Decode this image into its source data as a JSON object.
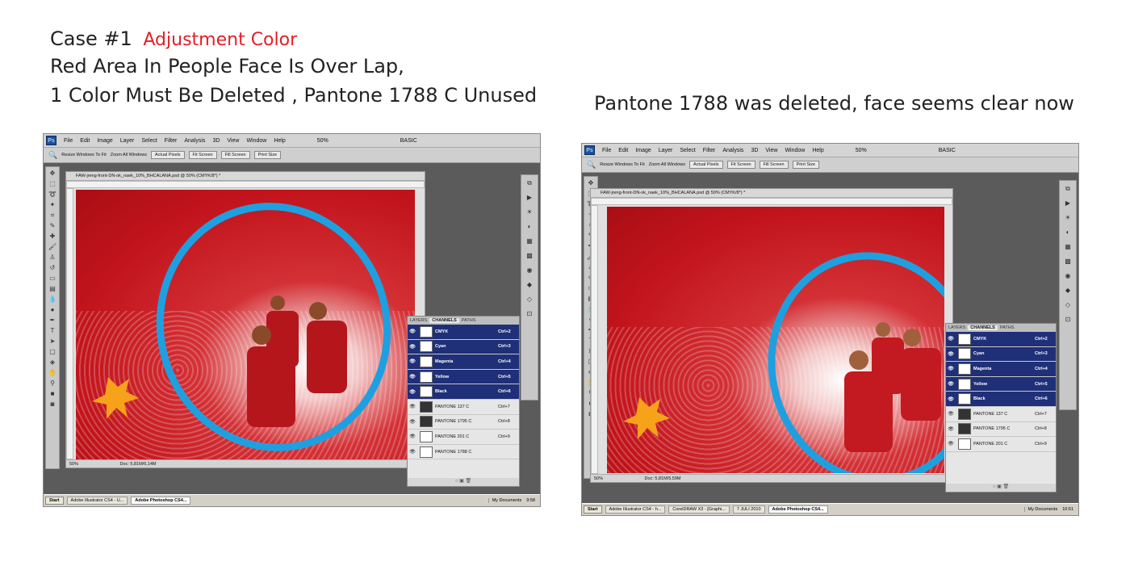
{
  "left_caption": {
    "case": "Case #1",
    "label": "Adjustment Color",
    "line2": "Red Area In People Face Is Over Lap,",
    "line3": "1 Color Must Be Deleted , Pantone 1788 C  Unused"
  },
  "right_caption": "Pantone 1788 was deleted, face seems clear now",
  "ps": {
    "logo": "Ps",
    "menus": [
      "File",
      "Edit",
      "Image",
      "Layer",
      "Select",
      "Filter",
      "Analysis",
      "3D",
      "View",
      "Window",
      "Help"
    ],
    "zoom_field": "50%",
    "workspace": "BASIC",
    "options": {
      "resize": "Resize Windows To Fit",
      "zoom_all": "Zoom All Windows",
      "actual": "Actual Pixels",
      "fit": "Fit Screen",
      "fill": "Fill Screen",
      "print": "Print Size"
    },
    "doc_title": "FAW-jreng-front-DN-ok_naek_10%_BHCALANA.psd @ 50% (CMYK/8*) *",
    "tabs": {
      "layers": "LAYERS",
      "channels": "CHANNELS",
      "paths": "PATHS"
    }
  },
  "left": {
    "status_zoom": "50%",
    "status_doc": "Doc: 5,81M/6,14M",
    "channels": [
      {
        "name": "CMYK",
        "key": "Ctrl+2",
        "sel": true
      },
      {
        "name": "Cyan",
        "key": "Ctrl+3",
        "sel": true
      },
      {
        "name": "Magenta",
        "key": "Ctrl+4",
        "sel": true
      },
      {
        "name": "Yellow",
        "key": "Ctrl+5",
        "sel": true
      },
      {
        "name": "Black",
        "key": "Ctrl+6",
        "sel": true
      },
      {
        "name": "PANTONE 137 C",
        "key": "Ctrl+7",
        "sel": false
      },
      {
        "name": "PANTONE 1795 C",
        "key": "Ctrl+8",
        "sel": false
      },
      {
        "name": "PANTONE 201 C",
        "key": "Ctrl+9",
        "sel": false
      },
      {
        "name": "PANTONE 1788 C",
        "key": "",
        "sel": false
      }
    ],
    "taskbar": {
      "start": "Start",
      "tasks": [
        "Adobe Illustrator CS4 - U...",
        "Adobe Photoshop CS4..."
      ],
      "tray_label": "My Documents",
      "time": "9:58"
    }
  },
  "right": {
    "status_zoom": "50%",
    "status_doc": "Doc: 5,81M/5,59M",
    "channels": [
      {
        "name": "CMYK",
        "key": "Ctrl+2",
        "sel": true
      },
      {
        "name": "Cyan",
        "key": "Ctrl+3",
        "sel": true
      },
      {
        "name": "Magenta",
        "key": "Ctrl+4",
        "sel": true
      },
      {
        "name": "Yellow",
        "key": "Ctrl+5",
        "sel": true
      },
      {
        "name": "Black",
        "key": "Ctrl+6",
        "sel": true
      },
      {
        "name": "PANTONE 137 C",
        "key": "Ctrl+7",
        "sel": false
      },
      {
        "name": "PANTONE 1795 C",
        "key": "Ctrl+8",
        "sel": false
      },
      {
        "name": "PANTONE 201 C",
        "key": "Ctrl+9",
        "sel": false
      }
    ],
    "taskbar": {
      "start": "Start",
      "tasks": [
        "Adobe Illustrator CS4 - h...",
        "CorelDRAW X3 - [Graphi...",
        "7 JULI 2010",
        "Adobe Photoshop CS4..."
      ],
      "tray_label": "My Documents",
      "time": "10:51"
    }
  },
  "colors": {
    "highlight_circle": "#1ea0e0",
    "star": "#f6a21a",
    "selected_channel": "#1f2f78"
  }
}
